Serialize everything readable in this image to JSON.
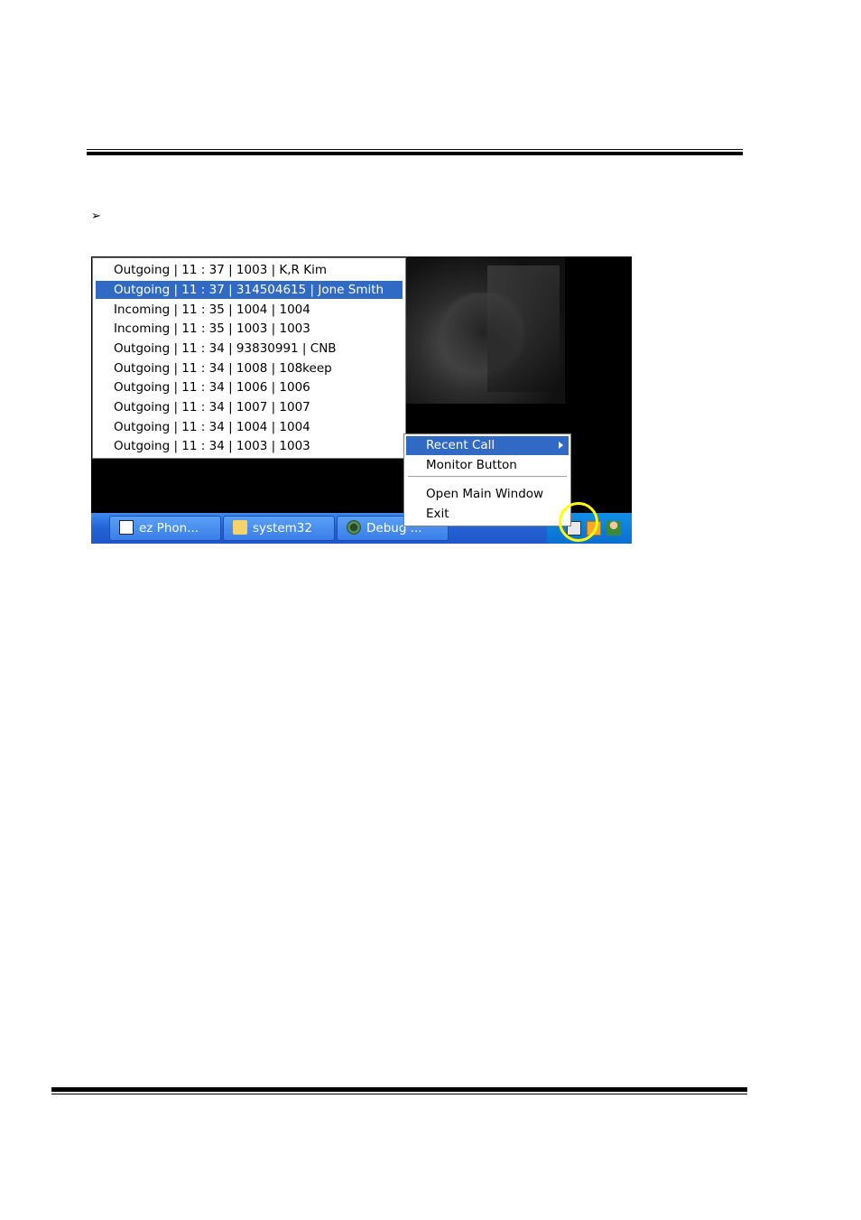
{
  "bullet_symbol": "➢",
  "recent_calls": [
    {
      "text": "Outgoing | 11 : 37 | 1003 | K,R Kim",
      "selected": false
    },
    {
      "text": "Outgoing | 11 : 37 | 314504615 | Jone Smith",
      "selected": true
    },
    {
      "text": "Incoming | 11 : 35 | 1004 | 1004",
      "selected": false
    },
    {
      "text": "Incoming | 11 : 35 | 1003 | 1003",
      "selected": false
    },
    {
      "text": "Outgoing | 11 : 34 | 93830991 | CNB",
      "selected": false
    },
    {
      "text": "Outgoing | 11 : 34 | 1008 | 108keep",
      "selected": false
    },
    {
      "text": "Outgoing | 11 : 34 | 1006 | 1006",
      "selected": false
    },
    {
      "text": "Outgoing | 11 : 34 | 1007 | 1007",
      "selected": false
    },
    {
      "text": "Outgoing | 11 : 34 | 1004 | 1004",
      "selected": false
    },
    {
      "text": "Outgoing | 11 : 34 | 1003 | 1003",
      "selected": false
    }
  ],
  "context_menu": {
    "recent_call": "Recent Call",
    "monitor_button": "Monitor Button",
    "open_main_window": "Open Main Window",
    "exit": "Exit"
  },
  "taskbar": {
    "buttons": [
      {
        "label": "ez Phon...",
        "icon": "word-document-icon"
      },
      {
        "label": "system32",
        "icon": "folder-icon"
      },
      {
        "label": "Debug ...",
        "icon": "bug-icon"
      }
    ],
    "tray_icons": [
      "ez-phone-tray-icon",
      "clock-tray-icon",
      "messenger-tray-icon"
    ],
    "highlight_color": "#ffff00"
  }
}
